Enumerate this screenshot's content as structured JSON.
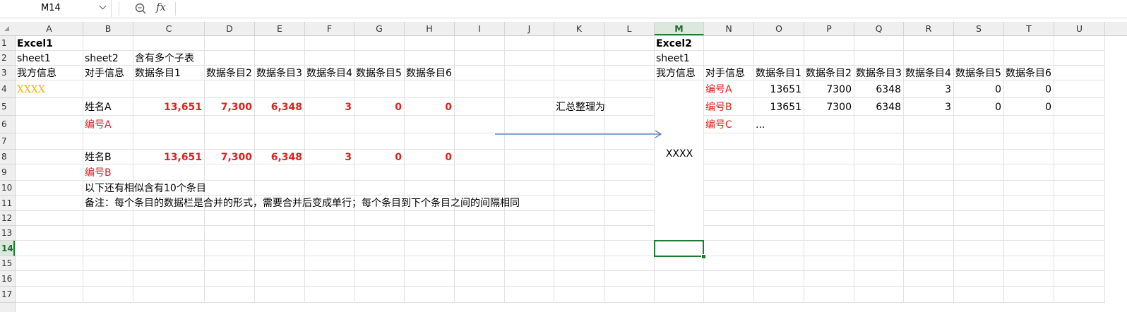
{
  "name_box": "M14",
  "formula_bar": {
    "fx_label": "fx",
    "value": ""
  },
  "columns": [
    "A",
    "B",
    "C",
    "D",
    "E",
    "F",
    "G",
    "H",
    "I",
    "J",
    "K",
    "L",
    "M",
    "N",
    "O",
    "P",
    "Q",
    "R",
    "S",
    "T",
    "U"
  ],
  "rows": [
    "1",
    "2",
    "3",
    "4",
    "5",
    "6",
    "7",
    "8",
    "9",
    "10",
    "11",
    "12",
    "13",
    "14",
    "15",
    "16",
    "17"
  ],
  "selected_cell": "M14",
  "cells": {
    "A1": "Excel1",
    "A2": "sheet1",
    "B2": "sheet2",
    "C2": "含有多个子表",
    "A3": "我方信息",
    "B3": "对手信息",
    "C3": "数据条目1",
    "D3": "数据条目2",
    "E3": "数据条目3",
    "F3": "数据条目4",
    "G3": "数据条目5",
    "H3": "数据条目6",
    "A4": "XXXX",
    "B5": "姓名A",
    "C5": "13,651",
    "D5": "7,300",
    "E5": "6,348",
    "F5": "3",
    "G5": "0",
    "H5": "0",
    "B6": "编号A",
    "K5": "汇总整理为",
    "B8": "姓名B",
    "C8": "13,651",
    "D8": "7,300",
    "E8": "6,348",
    "F8": "3",
    "G8": "0",
    "H8": "0",
    "B9": "编号B",
    "B10": "以下还有相似含有10个条目",
    "B11": "备注：每个条目的数据栏是合并的形式，需要合并后变成单行；每个条目到下个条目之间的间隔相同",
    "M1": "Excel2",
    "M2": "sheet1",
    "M3": "我方信息",
    "N3": "对手信息",
    "O3": "数据条目1",
    "P3": "数据条目2",
    "Q3": "数据条目3",
    "R3": "数据条目4",
    "S3": "数据条目5",
    "T3": "数据条目6",
    "M_merged": "XXXX",
    "N4": "编号A",
    "O4": "13651",
    "P4": "7300",
    "Q4": "6348",
    "R4": "3",
    "S4": "0",
    "T4": "0",
    "N5": "编号B",
    "O5": "13651",
    "P5": "7300",
    "Q5": "6348",
    "R5": "3",
    "S5": "0",
    "T5": "0",
    "N6": "编号C",
    "O6": "..."
  },
  "colors": {
    "accent_green": "#1f7a35",
    "red_text": "#e0201c",
    "gold_text": "#f2b300",
    "arrow_blue": "#4472c4"
  }
}
